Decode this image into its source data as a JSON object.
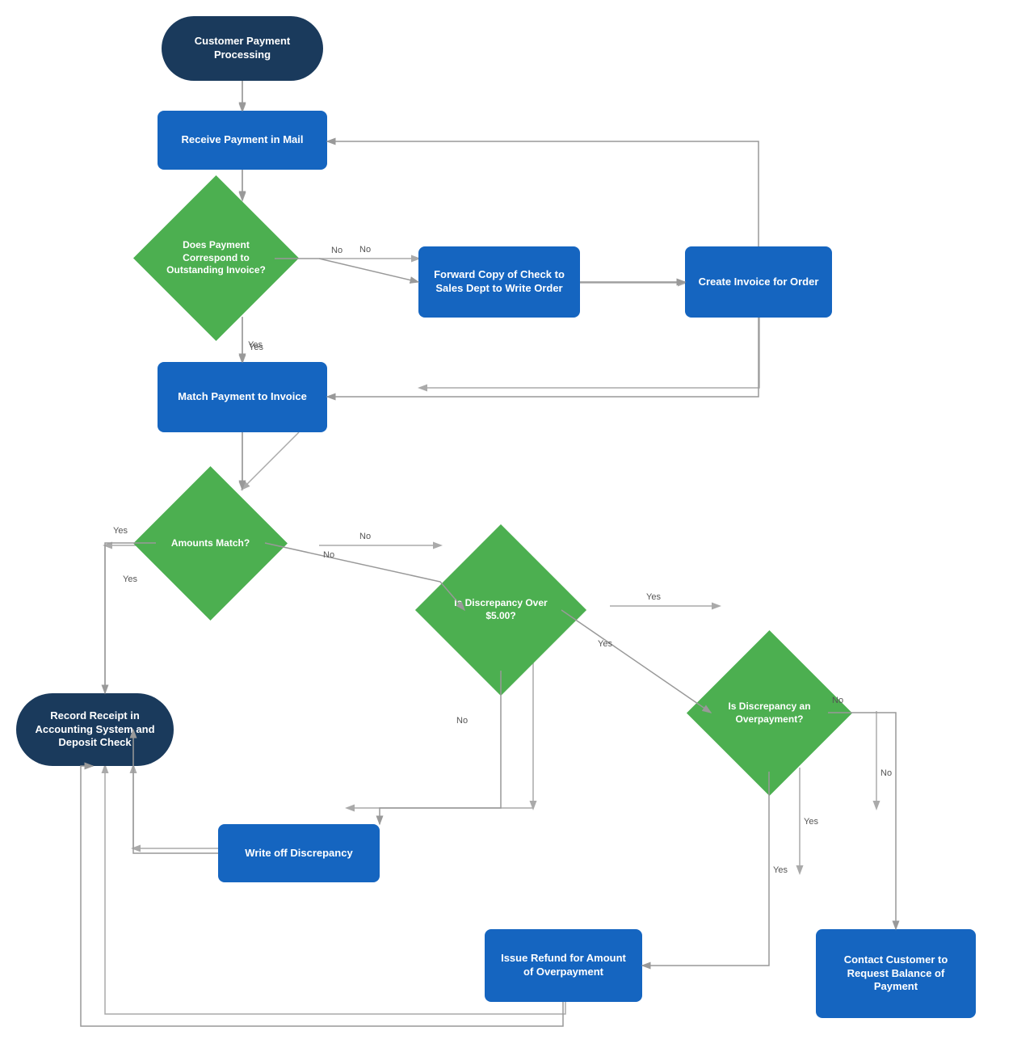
{
  "nodes": {
    "start": {
      "label": "Customer Payment Processing",
      "type": "oval"
    },
    "receive_payment": {
      "label": "Receive Payment in Mail",
      "type": "rect"
    },
    "does_payment_correspond": {
      "label": "Does Payment Correspond to Outstanding Invoice?",
      "type": "diamond"
    },
    "forward_check": {
      "label": "Forward Copy of Check to Sales Dept to Write Order",
      "type": "rect"
    },
    "create_invoice": {
      "label": "Create Invoice for Order",
      "type": "rect"
    },
    "match_payment": {
      "label": "Match Payment to Invoice",
      "type": "rect"
    },
    "amounts_match": {
      "label": "Amounts Match?",
      "type": "diamond"
    },
    "discrepancy_over": {
      "label": "Is Discrepancy Over $5.00?",
      "type": "diamond"
    },
    "record_receipt": {
      "label": "Record Receipt in Accounting System and Deposit Check",
      "type": "oval"
    },
    "is_overpayment": {
      "label": "Is Discrepancy an Overpayment?",
      "type": "diamond"
    },
    "write_off": {
      "label": "Write off Discrepancy",
      "type": "rect"
    },
    "issue_refund": {
      "label": "Issue Refund for Amount of Overpayment",
      "type": "rect"
    },
    "contact_customer": {
      "label": "Contact Customer to Request Balance of Payment",
      "type": "rect"
    }
  },
  "labels": {
    "yes": "Yes",
    "no": "No"
  }
}
